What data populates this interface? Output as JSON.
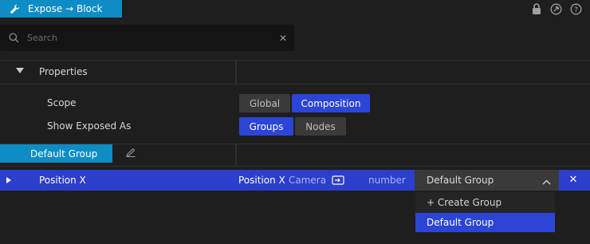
{
  "header": {
    "title": "Expose → Block",
    "icons": [
      "wrench-icon",
      "lock-icon",
      "pin-icon",
      "help-icon"
    ]
  },
  "search": {
    "placeholder": "Search",
    "value": ""
  },
  "properties": {
    "section_label": "Properties",
    "scope": {
      "label": "Scope",
      "options": [
        "Global",
        "Composition"
      ],
      "selected": "Composition"
    },
    "show_exposed_as": {
      "label": "Show Exposed As",
      "options": [
        "Groups",
        "Nodes"
      ],
      "selected": "Groups"
    }
  },
  "group": {
    "name": "Default Group"
  },
  "row": {
    "name": "Position X",
    "exposed_name": "Position X",
    "source": "Camera",
    "type": "number",
    "group_value": "Default Group"
  },
  "dropdown_menu": {
    "items": [
      "+ Create Group",
      "Default Group"
    ],
    "highlighted": "Default Group"
  },
  "colors": {
    "accent_blue": "#0e8cc4",
    "selection_blue": "#2c45d6",
    "background": "#1e1e1e"
  }
}
